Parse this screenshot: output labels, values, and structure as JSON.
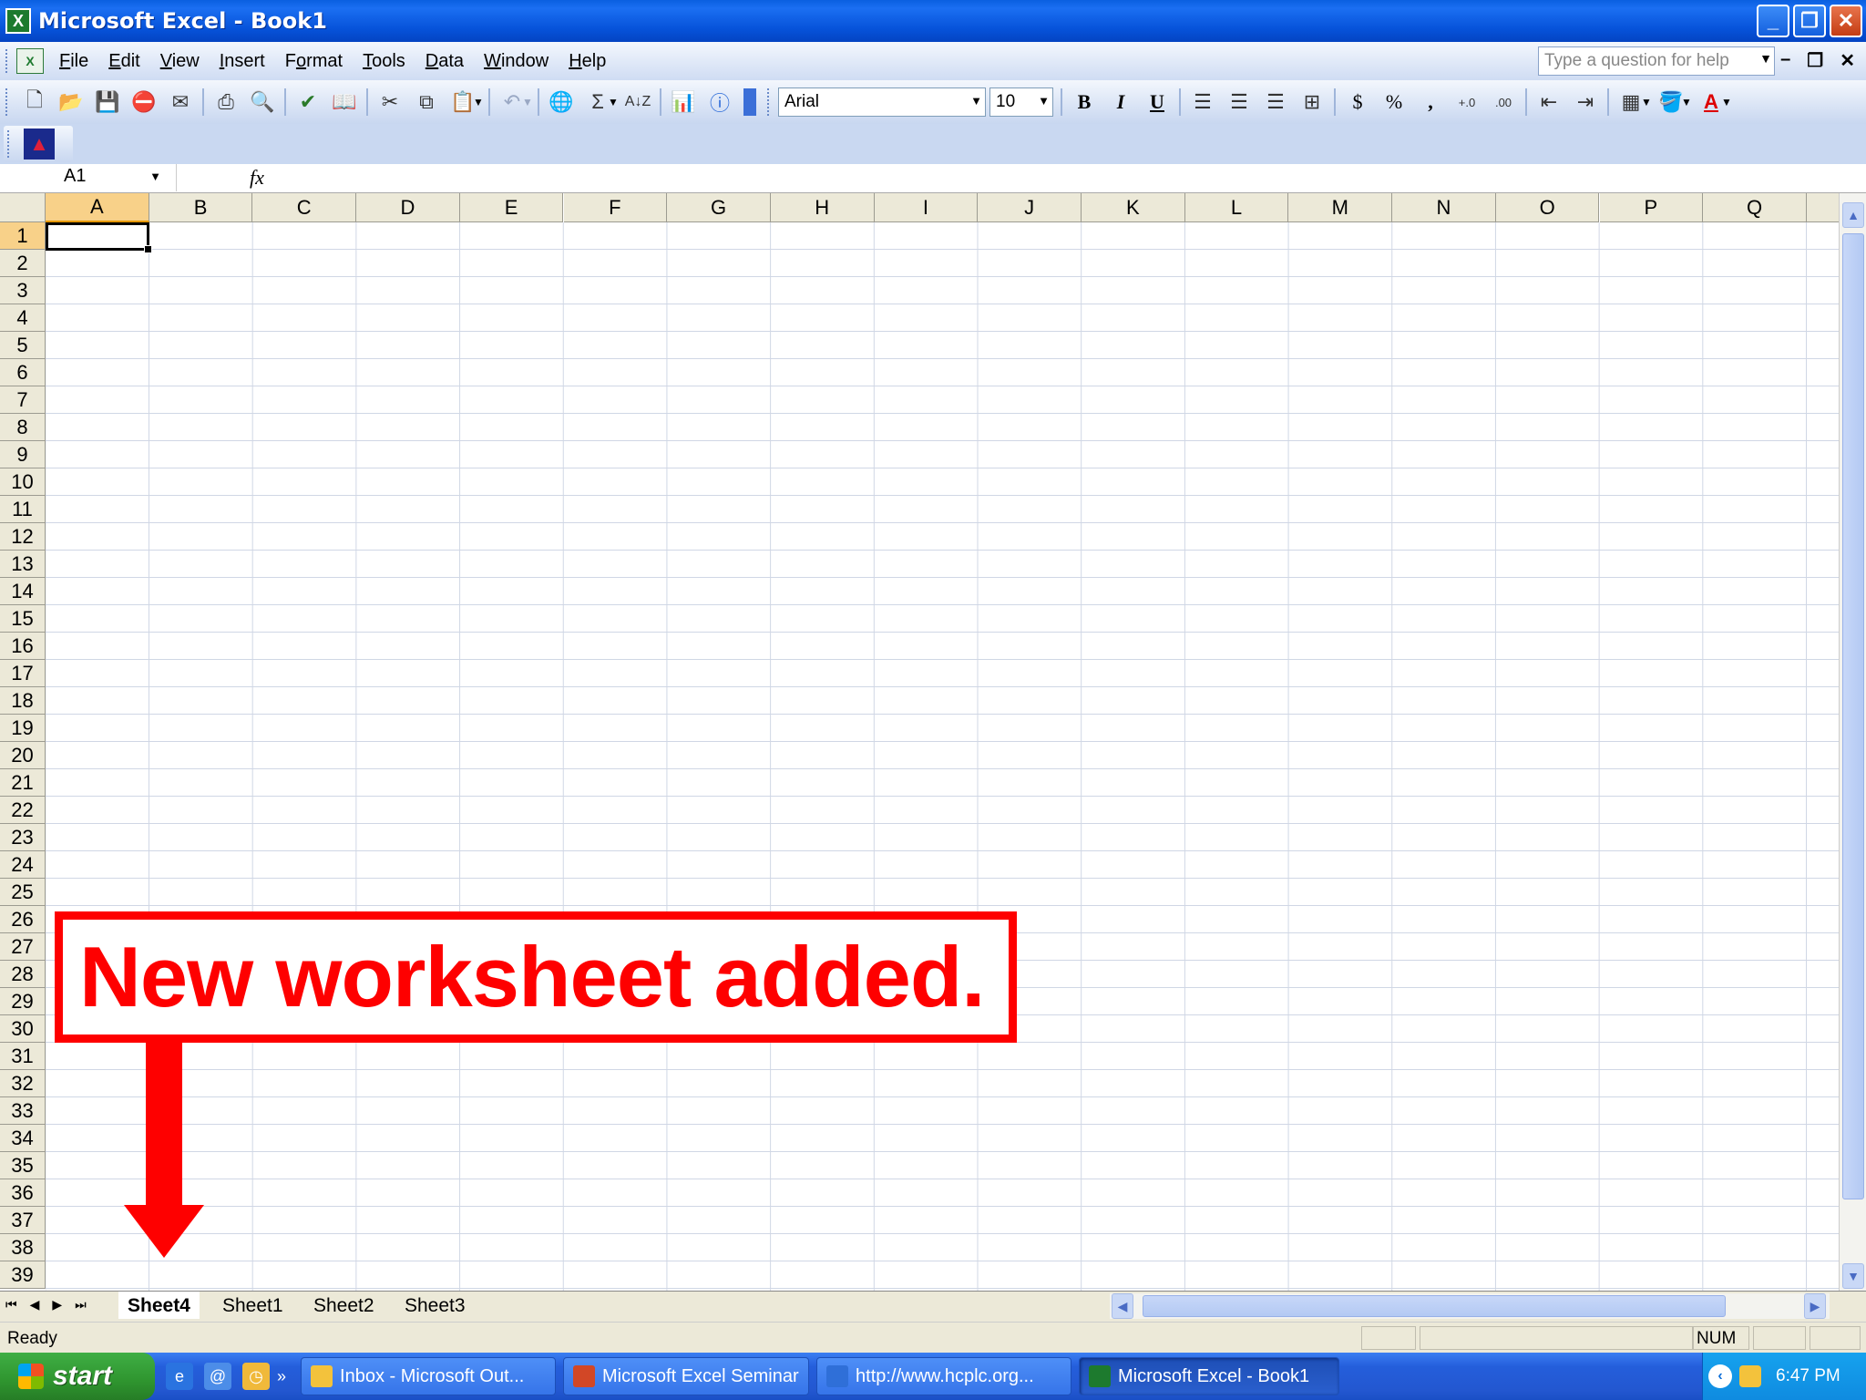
{
  "window": {
    "title": "Microsoft Excel - Book1"
  },
  "menu": {
    "items": [
      {
        "label": "File",
        "key": "F",
        "rest": "ile"
      },
      {
        "label": "Edit",
        "key": "E",
        "rest": "dit"
      },
      {
        "label": "View",
        "key": "V",
        "rest": "iew"
      },
      {
        "label": "Insert",
        "key": "I",
        "rest": "nsert"
      },
      {
        "label": "Format",
        "pre": "F",
        "key": "o",
        "rest": "rmat"
      },
      {
        "label": "Tools",
        "key": "T",
        "rest": "ools"
      },
      {
        "label": "Data",
        "key": "D",
        "rest": "ata"
      },
      {
        "label": "Window",
        "key": "W",
        "rest": "indow"
      },
      {
        "label": "Help",
        "key": "H",
        "rest": "elp"
      }
    ],
    "help_placeholder": "Type a question for help"
  },
  "formatting": {
    "font": "Arial",
    "size": "10",
    "bold": "B",
    "italic": "I",
    "underline": "U",
    "currency": "$",
    "percent": "%",
    "comma": ","
  },
  "formula_bar": {
    "name_box": "A1",
    "fx": "fx",
    "content": ""
  },
  "grid": {
    "columns": [
      "A",
      "B",
      "C",
      "D",
      "E",
      "F",
      "G",
      "H",
      "I",
      "J",
      "K",
      "L",
      "M",
      "N",
      "O",
      "P",
      "Q"
    ],
    "rows": [
      "1",
      "2",
      "3",
      "4",
      "5",
      "6",
      "7",
      "8",
      "9",
      "10",
      "11",
      "12",
      "13",
      "14",
      "15",
      "16",
      "17",
      "18",
      "19",
      "20",
      "21",
      "22",
      "23",
      "24",
      "25",
      "26",
      "27",
      "28",
      "29",
      "30",
      "31",
      "32",
      "33",
      "34",
      "35",
      "36",
      "37",
      "38",
      "39"
    ],
    "active_cell": "A1"
  },
  "sheet_tabs": [
    "Sheet4",
    "Sheet1",
    "Sheet2",
    "Sheet3"
  ],
  "active_sheet": "Sheet4",
  "status": {
    "text": "Ready",
    "num": "NUM"
  },
  "taskbar": {
    "start_label": "start",
    "buttons": [
      {
        "label": "Inbox - Microsoft Out...",
        "icon_color": "#f3c23c"
      },
      {
        "label": "Microsoft Excel Seminar",
        "icon_color": "#d24726"
      },
      {
        "label": "http://www.hcplc.org...",
        "icon_color": "#2f6fd8"
      },
      {
        "label": "Microsoft Excel - Book1",
        "icon_color": "#1d7a2e",
        "active": true
      }
    ],
    "clock": "6:47 PM"
  },
  "annotation": {
    "text": "New worksheet added."
  },
  "colors": {
    "annotation": "#fe0000",
    "selection_header": "#f8d189",
    "title_bar": "#0652d9"
  }
}
